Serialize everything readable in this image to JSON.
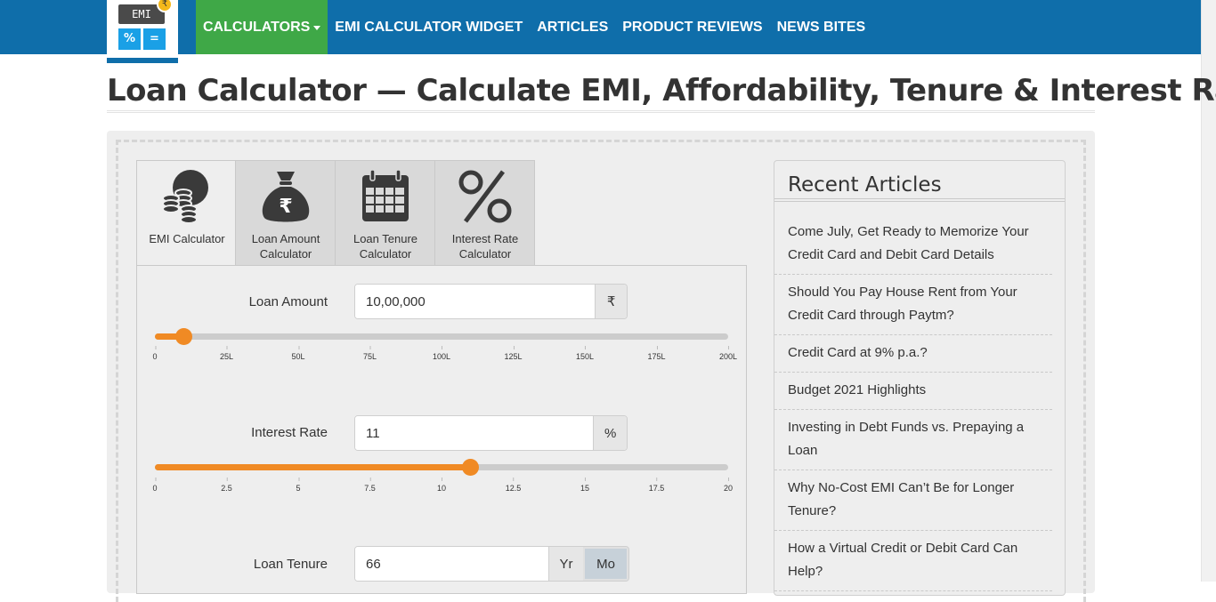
{
  "logo": {
    "screen_text": "EMI",
    "btn_left": "%",
    "btn_right": "=",
    "coin": "₹"
  },
  "nav": [
    {
      "label": "CALCULATORS",
      "active": true,
      "dropdown": true
    },
    {
      "label": "EMI CALCULATOR WIDGET"
    },
    {
      "label": "ARTICLES"
    },
    {
      "label": "PRODUCT REVIEWS"
    },
    {
      "label": "NEWS BITES"
    }
  ],
  "page": {
    "title": "Loan Calculator — Calculate EMI, Affordability, Tenure & Interest Rate"
  },
  "tabs": [
    {
      "label": "EMI Calculator",
      "icon": "coins-icon",
      "active": true
    },
    {
      "label": "Loan Amount Calculator",
      "icon": "money-bag-icon"
    },
    {
      "label": "Loan Tenure Calculator",
      "icon": "calendar-icon"
    },
    {
      "label": "Interest Rate Calculator",
      "icon": "percent-icon"
    }
  ],
  "form": {
    "loan_amount": {
      "label": "Loan Amount",
      "value": "10,00,000",
      "unit": "₹",
      "slider_fraction": 0.05,
      "ticks": [
        "0",
        "25L",
        "50L",
        "75L",
        "100L",
        "125L",
        "150L",
        "175L",
        "200L"
      ]
    },
    "interest_rate": {
      "label": "Interest Rate",
      "value": "11",
      "unit": "%",
      "slider_fraction": 0.55,
      "ticks": [
        "0",
        "2.5",
        "5",
        "7.5",
        "10",
        "12.5",
        "15",
        "17.5",
        "20"
      ]
    },
    "loan_tenure": {
      "label": "Loan Tenure",
      "value": "66",
      "unit_year": "Yr",
      "unit_month": "Mo",
      "selected_unit": "Mo"
    }
  },
  "sidebar": {
    "title": "Recent Articles",
    "articles": [
      "Come July, Get Ready to Memorize Your Credit Card and Debit Card Details",
      "Should You Pay House Rent from Your Credit Card through Paytm?",
      "Credit Card at 9% p.a.?",
      "Budget 2021 Highlights",
      "Investing in Debt Funds vs. Prepaying a Loan",
      "Why No-Cost EMI Can’t Be for Longer Tenure?",
      "How a Virtual Credit or Debit Card Can Help?"
    ]
  },
  "colors": {
    "header": "#0f6eaa",
    "nav_active": "#3fa847",
    "slider": "#f08a24",
    "panel": "#eeeeee"
  }
}
